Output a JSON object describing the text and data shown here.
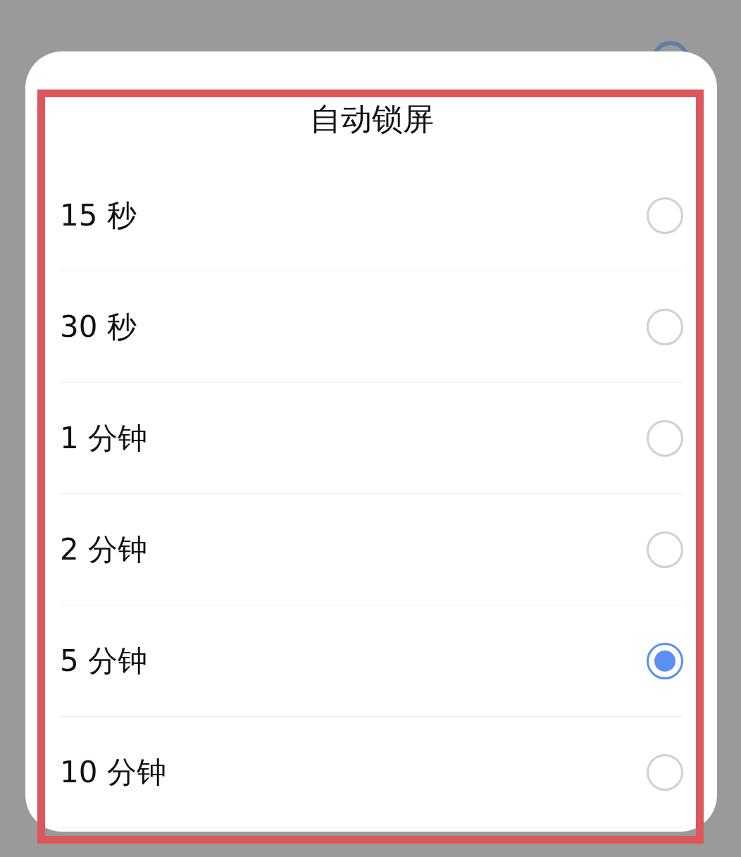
{
  "dialog": {
    "title": "自动锁屏",
    "options": [
      {
        "label": "15 秒",
        "selected": false
      },
      {
        "label": "30 秒",
        "selected": false
      },
      {
        "label": "1 分钟",
        "selected": false
      },
      {
        "label": "2 分钟",
        "selected": false
      },
      {
        "label": "5 分钟",
        "selected": true
      },
      {
        "label": "10 分钟",
        "selected": false
      }
    ]
  }
}
